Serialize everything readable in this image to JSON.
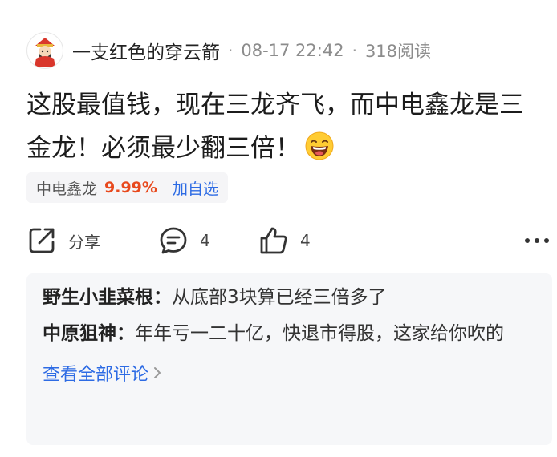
{
  "post": {
    "author": "一支红色的穿云箭",
    "separator": "·",
    "time": "08-17 22:42",
    "reads": "318阅读",
    "content": "这股最值钱，现在三龙齐飞，而中电鑫龙是三金龙！必须最少翻三倍！",
    "emoji": "laughing-emoji"
  },
  "stock": {
    "name": "中电鑫龙",
    "change": "9.99%",
    "add_label": "加自选",
    "change_color": "#e8491d"
  },
  "actions": {
    "share_label": "分享",
    "comment_count": "4",
    "like_count": "4"
  },
  "comments": [
    {
      "user": "野生小韭菜根",
      "colon": "：",
      "text": "从底部3块算已经三倍多了"
    },
    {
      "user": "中原狙神",
      "colon": "：",
      "text": "年年亏一二十亿，快退市得股，这家给你吹的"
    }
  ],
  "view_all_label": "查看全部评论",
  "colors": {
    "link": "#2d6be4",
    "up": "#e8491d"
  }
}
